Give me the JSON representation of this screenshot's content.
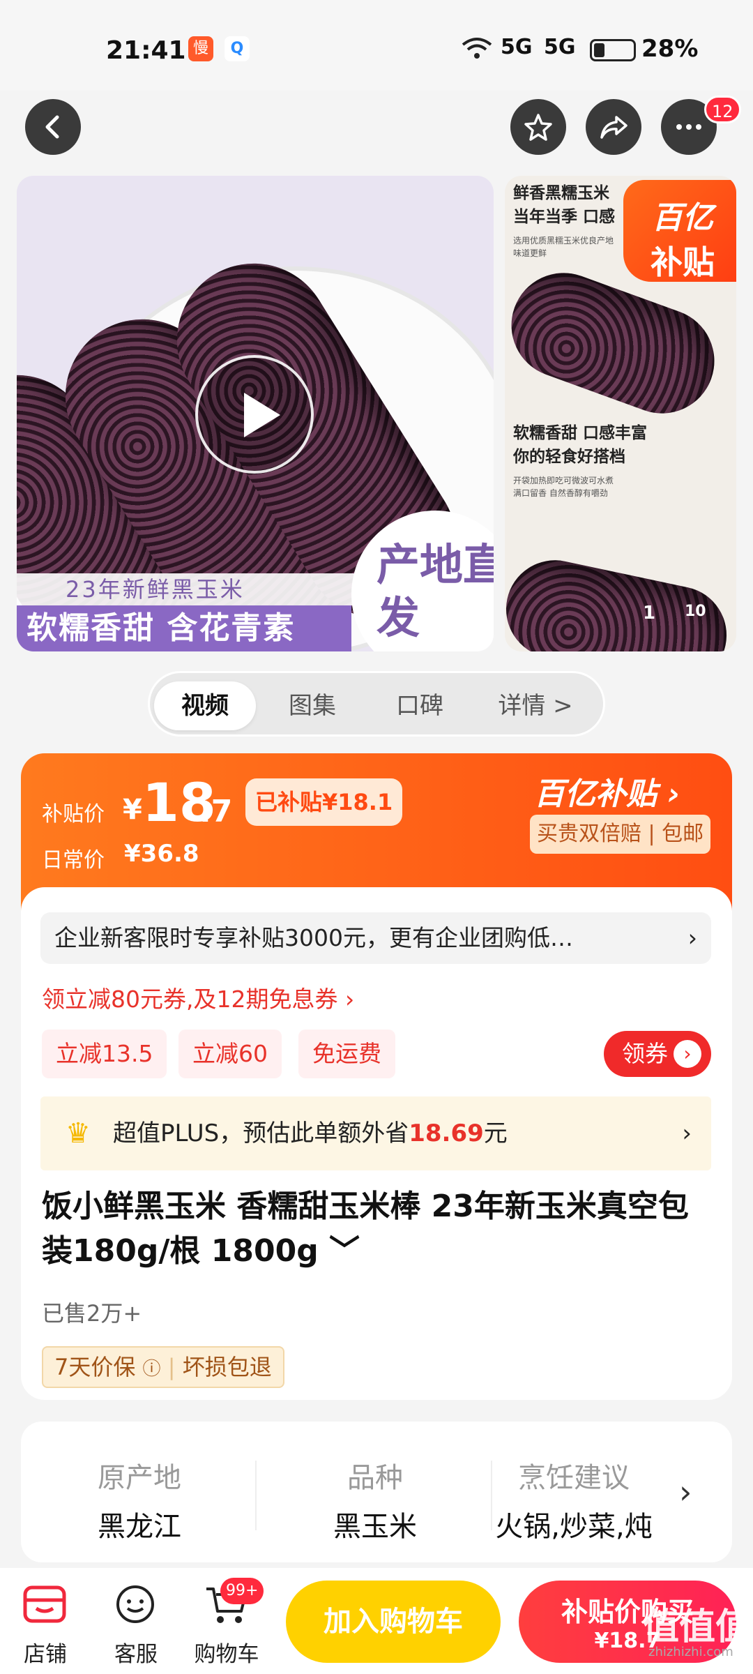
{
  "status": {
    "time": "21:41",
    "app_icon_1": "慢",
    "app_icon_2": "Q",
    "signal_1": "5G",
    "signal_2": "5G",
    "battery_pct": "28%",
    "battery_level": 0.28
  },
  "topbar": {
    "notif_count": "12"
  },
  "gallery": {
    "main_caption_1": "23年新鲜黑玉米",
    "main_caption_2": "软糯香甜 含花青素",
    "main_badge": "产地直发",
    "side_title_1": "鲜香黑糯玉米",
    "side_title_2": "当年当季 口感",
    "side_small_1": "选用优质黑糯玉米优良产地",
    "side_small_2": "味道更鲜",
    "side_title_3": "软糯香甜 口感丰富",
    "side_title_4": "你的轻食好搭档",
    "side_small_3": "开袋加热即吃可微波可水煮",
    "side_small_4": "满口留香 自然香醇有嚼劲",
    "subsidy_brand": "百亿",
    "subsidy_word": "补贴",
    "page_current": "1",
    "page_total": "10"
  },
  "tabs": [
    {
      "label": "视频"
    },
    {
      "label": "图集"
    },
    {
      "label": "口碑"
    },
    {
      "label": "详情 >"
    }
  ],
  "price": {
    "subsidy_label": "补贴价",
    "currency": "¥",
    "price_int": "18",
    "price_dec": ".7",
    "subsidized_badge": "已补贴¥18.1",
    "daily_label": "日常价",
    "daily_price": "¥36.8",
    "brand": "百亿补贴",
    "brand_sub": "买贵双倍赔 | 包邮"
  },
  "promo": {
    "enterprise": "企业新客限时专享补贴3000元，更有企业团购低…",
    "coupon_line": "领立减80元券,及12期免息券 ›",
    "chips": [
      "立减13.5",
      "立减60",
      "免运费"
    ],
    "get_coupon": "领券",
    "plus_prefix": "超值PLUS，预估此单额外省",
    "plus_amount": "18.69",
    "plus_suffix": "元"
  },
  "product": {
    "title": "饭小鲜黑玉米 香糯甜玉米棒 23年新玉米真空包装180g/根 1800g",
    "sold": "已售2万+",
    "guarantee_1": "7天价保",
    "guarantee_2": "坏损包退"
  },
  "attributes": [
    {
      "key": "原产地",
      "value": "黑龙江"
    },
    {
      "key": "品种",
      "value": "黑玉米"
    },
    {
      "key": "烹饪建议",
      "value": "火锅,炒菜,炖"
    }
  ],
  "bottom": {
    "store": "店铺",
    "service": "客服",
    "cart": "购物车",
    "cart_badge": "99+",
    "add_cart": "加入购物车",
    "buy_line1": "补贴价购买",
    "buy_line2": "¥18.7",
    "watermark": "值值值",
    "watermark_url": "zhizhizhi.com"
  },
  "colors": {
    "accent": "#ff4e12",
    "red": "#f02a2a",
    "yellow": "#ffd100"
  }
}
